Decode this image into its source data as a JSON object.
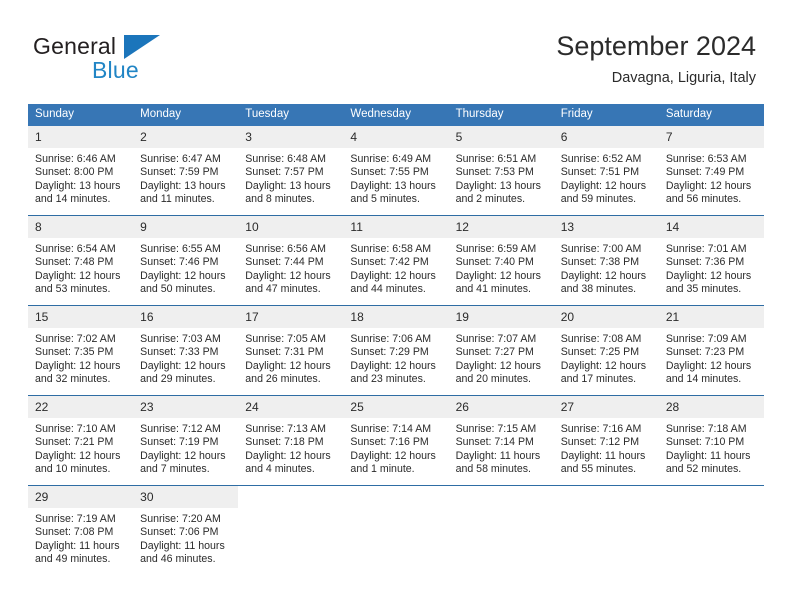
{
  "brand": {
    "name_part1": "General",
    "name_part2": "Blue",
    "triangle_color": "#1b75bb",
    "blue_color": "#2185c5"
  },
  "header": {
    "title": "September 2024",
    "subtitle": "Davagna, Liguria, Italy"
  },
  "theme": {
    "header_bg": "#3776b5",
    "daynum_bg": "#efefef",
    "week_divider": "#2e6da4",
    "text": "#2b2b2b"
  },
  "weekdays": [
    "Sunday",
    "Monday",
    "Tuesday",
    "Wednesday",
    "Thursday",
    "Friday",
    "Saturday"
  ],
  "labels": {
    "sunrise_prefix": "Sunrise:",
    "sunset_prefix": "Sunset:",
    "daylight_prefix": "Daylight:"
  },
  "weeks": [
    [
      {
        "day": "1",
        "sunrise": "Sunrise: 6:46 AM",
        "sunset": "Sunset: 8:00 PM",
        "daylight_line1": "Daylight: 13 hours",
        "daylight_line2": "and 14 minutes."
      },
      {
        "day": "2",
        "sunrise": "Sunrise: 6:47 AM",
        "sunset": "Sunset: 7:59 PM",
        "daylight_line1": "Daylight: 13 hours",
        "daylight_line2": "and 11 minutes."
      },
      {
        "day": "3",
        "sunrise": "Sunrise: 6:48 AM",
        "sunset": "Sunset: 7:57 PM",
        "daylight_line1": "Daylight: 13 hours",
        "daylight_line2": "and 8 minutes."
      },
      {
        "day": "4",
        "sunrise": "Sunrise: 6:49 AM",
        "sunset": "Sunset: 7:55 PM",
        "daylight_line1": "Daylight: 13 hours",
        "daylight_line2": "and 5 minutes."
      },
      {
        "day": "5",
        "sunrise": "Sunrise: 6:51 AM",
        "sunset": "Sunset: 7:53 PM",
        "daylight_line1": "Daylight: 13 hours",
        "daylight_line2": "and 2 minutes."
      },
      {
        "day": "6",
        "sunrise": "Sunrise: 6:52 AM",
        "sunset": "Sunset: 7:51 PM",
        "daylight_line1": "Daylight: 12 hours",
        "daylight_line2": "and 59 minutes."
      },
      {
        "day": "7",
        "sunrise": "Sunrise: 6:53 AM",
        "sunset": "Sunset: 7:49 PM",
        "daylight_line1": "Daylight: 12 hours",
        "daylight_line2": "and 56 minutes."
      }
    ],
    [
      {
        "day": "8",
        "sunrise": "Sunrise: 6:54 AM",
        "sunset": "Sunset: 7:48 PM",
        "daylight_line1": "Daylight: 12 hours",
        "daylight_line2": "and 53 minutes."
      },
      {
        "day": "9",
        "sunrise": "Sunrise: 6:55 AM",
        "sunset": "Sunset: 7:46 PM",
        "daylight_line1": "Daylight: 12 hours",
        "daylight_line2": "and 50 minutes."
      },
      {
        "day": "10",
        "sunrise": "Sunrise: 6:56 AM",
        "sunset": "Sunset: 7:44 PM",
        "daylight_line1": "Daylight: 12 hours",
        "daylight_line2": "and 47 minutes."
      },
      {
        "day": "11",
        "sunrise": "Sunrise: 6:58 AM",
        "sunset": "Sunset: 7:42 PM",
        "daylight_line1": "Daylight: 12 hours",
        "daylight_line2": "and 44 minutes."
      },
      {
        "day": "12",
        "sunrise": "Sunrise: 6:59 AM",
        "sunset": "Sunset: 7:40 PM",
        "daylight_line1": "Daylight: 12 hours",
        "daylight_line2": "and 41 minutes."
      },
      {
        "day": "13",
        "sunrise": "Sunrise: 7:00 AM",
        "sunset": "Sunset: 7:38 PM",
        "daylight_line1": "Daylight: 12 hours",
        "daylight_line2": "and 38 minutes."
      },
      {
        "day": "14",
        "sunrise": "Sunrise: 7:01 AM",
        "sunset": "Sunset: 7:36 PM",
        "daylight_line1": "Daylight: 12 hours",
        "daylight_line2": "and 35 minutes."
      }
    ],
    [
      {
        "day": "15",
        "sunrise": "Sunrise: 7:02 AM",
        "sunset": "Sunset: 7:35 PM",
        "daylight_line1": "Daylight: 12 hours",
        "daylight_line2": "and 32 minutes."
      },
      {
        "day": "16",
        "sunrise": "Sunrise: 7:03 AM",
        "sunset": "Sunset: 7:33 PM",
        "daylight_line1": "Daylight: 12 hours",
        "daylight_line2": "and 29 minutes."
      },
      {
        "day": "17",
        "sunrise": "Sunrise: 7:05 AM",
        "sunset": "Sunset: 7:31 PM",
        "daylight_line1": "Daylight: 12 hours",
        "daylight_line2": "and 26 minutes."
      },
      {
        "day": "18",
        "sunrise": "Sunrise: 7:06 AM",
        "sunset": "Sunset: 7:29 PM",
        "daylight_line1": "Daylight: 12 hours",
        "daylight_line2": "and 23 minutes."
      },
      {
        "day": "19",
        "sunrise": "Sunrise: 7:07 AM",
        "sunset": "Sunset: 7:27 PM",
        "daylight_line1": "Daylight: 12 hours",
        "daylight_line2": "and 20 minutes."
      },
      {
        "day": "20",
        "sunrise": "Sunrise: 7:08 AM",
        "sunset": "Sunset: 7:25 PM",
        "daylight_line1": "Daylight: 12 hours",
        "daylight_line2": "and 17 minutes."
      },
      {
        "day": "21",
        "sunrise": "Sunrise: 7:09 AM",
        "sunset": "Sunset: 7:23 PM",
        "daylight_line1": "Daylight: 12 hours",
        "daylight_line2": "and 14 minutes."
      }
    ],
    [
      {
        "day": "22",
        "sunrise": "Sunrise: 7:10 AM",
        "sunset": "Sunset: 7:21 PM",
        "daylight_line1": "Daylight: 12 hours",
        "daylight_line2": "and 10 minutes."
      },
      {
        "day": "23",
        "sunrise": "Sunrise: 7:12 AM",
        "sunset": "Sunset: 7:19 PM",
        "daylight_line1": "Daylight: 12 hours",
        "daylight_line2": "and 7 minutes."
      },
      {
        "day": "24",
        "sunrise": "Sunrise: 7:13 AM",
        "sunset": "Sunset: 7:18 PM",
        "daylight_line1": "Daylight: 12 hours",
        "daylight_line2": "and 4 minutes."
      },
      {
        "day": "25",
        "sunrise": "Sunrise: 7:14 AM",
        "sunset": "Sunset: 7:16 PM",
        "daylight_line1": "Daylight: 12 hours",
        "daylight_line2": "and 1 minute."
      },
      {
        "day": "26",
        "sunrise": "Sunrise: 7:15 AM",
        "sunset": "Sunset: 7:14 PM",
        "daylight_line1": "Daylight: 11 hours",
        "daylight_line2": "and 58 minutes."
      },
      {
        "day": "27",
        "sunrise": "Sunrise: 7:16 AM",
        "sunset": "Sunset: 7:12 PM",
        "daylight_line1": "Daylight: 11 hours",
        "daylight_line2": "and 55 minutes."
      },
      {
        "day": "28",
        "sunrise": "Sunrise: 7:18 AM",
        "sunset": "Sunset: 7:10 PM",
        "daylight_line1": "Daylight: 11 hours",
        "daylight_line2": "and 52 minutes."
      }
    ],
    [
      {
        "day": "29",
        "sunrise": "Sunrise: 7:19 AM",
        "sunset": "Sunset: 7:08 PM",
        "daylight_line1": "Daylight: 11 hours",
        "daylight_line2": "and 49 minutes."
      },
      {
        "day": "30",
        "sunrise": "Sunrise: 7:20 AM",
        "sunset": "Sunset: 7:06 PM",
        "daylight_line1": "Daylight: 11 hours",
        "daylight_line2": "and 46 minutes."
      },
      {
        "day": "",
        "sunrise": "",
        "sunset": "",
        "daylight_line1": "",
        "daylight_line2": ""
      },
      {
        "day": "",
        "sunrise": "",
        "sunset": "",
        "daylight_line1": "",
        "daylight_line2": ""
      },
      {
        "day": "",
        "sunrise": "",
        "sunset": "",
        "daylight_line1": "",
        "daylight_line2": ""
      },
      {
        "day": "",
        "sunrise": "",
        "sunset": "",
        "daylight_line1": "",
        "daylight_line2": ""
      },
      {
        "day": "",
        "sunrise": "",
        "sunset": "",
        "daylight_line1": "",
        "daylight_line2": ""
      }
    ]
  ]
}
